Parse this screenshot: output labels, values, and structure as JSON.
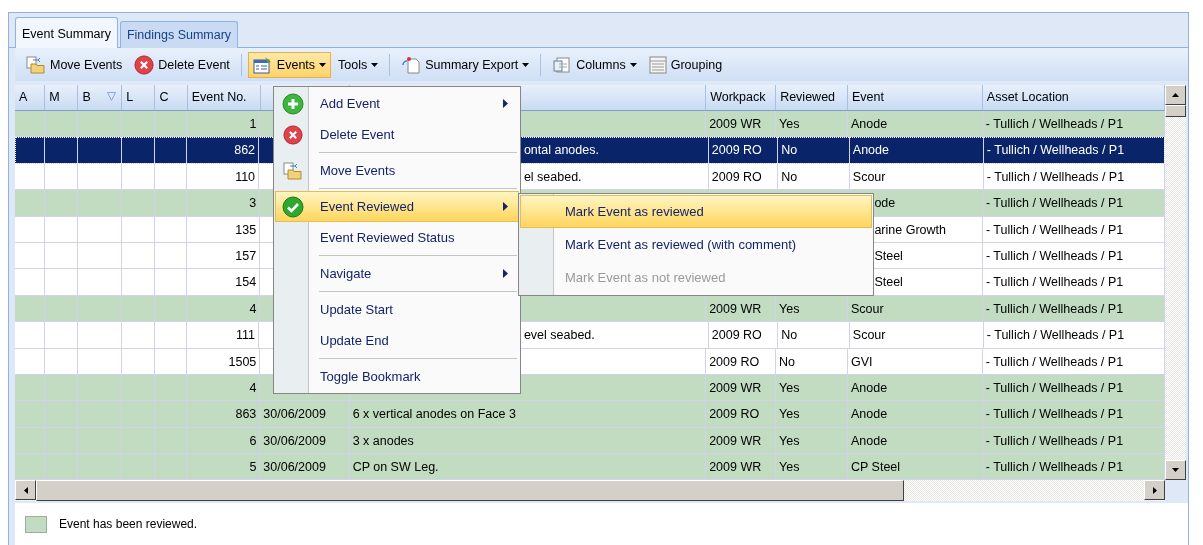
{
  "tabs": [
    {
      "label": "Event Summary",
      "selected": true
    },
    {
      "label": "Findings Summary",
      "selected": false
    }
  ],
  "toolbar": [
    [
      {
        "label": "Move Events",
        "kind": "move",
        "dropdown": false,
        "pressed": false
      },
      {
        "label": "Delete Event",
        "kind": "delete",
        "dropdown": false,
        "pressed": false
      }
    ],
    [
      {
        "label": "Events",
        "kind": "form",
        "dropdown": true,
        "pressed": true
      },
      {
        "label": "Tools",
        "dropdown": true,
        "pressed": false
      }
    ],
    [
      {
        "label": "Summary Export",
        "kind": "export",
        "dropdown": true,
        "pressed": false
      }
    ],
    [
      {
        "label": "Columns",
        "kind": "columns",
        "dropdown": true,
        "pressed": false
      },
      {
        "label": "Grouping",
        "kind": "grouping",
        "dropdown": false,
        "pressed": false
      }
    ]
  ],
  "grid": {
    "columns": {
      "a": "A",
      "m": "M",
      "b": "B",
      "l": "L",
      "c": "C",
      "event_no": "Event No.",
      "workpack": "Workpack",
      "reviewed": "Reviewed",
      "event": "Event",
      "asset_location": "Asset Location"
    },
    "rows": [
      {
        "selected": false,
        "is_reviewed": true,
        "event_no": "1",
        "workpack": "2009 WR",
        "reviewed": "Yes",
        "event": "Anode",
        "asset_location": "- Tullich / Wellheads / P1"
      },
      {
        "selected": true,
        "is_reviewed": false,
        "event_no": "862",
        "description": "ontal anodes.",
        "description_cut": true,
        "workpack": "2009 RO",
        "reviewed": "No",
        "event": "Anode",
        "asset_location": "- Tullich / Wellheads / P1"
      },
      {
        "selected": false,
        "is_reviewed": false,
        "event_no": "110",
        "description": "el seabed.",
        "description_cut": true,
        "workpack": "2009 RO",
        "reviewed": "No",
        "event": "Scour",
        "asset_location": "- Tullich / Wellheads / P1"
      },
      {
        "selected": false,
        "is_reviewed": true,
        "event_no": "3",
        "event": "ode",
        "event_cut": true,
        "asset_location": "- Tullich / Wellheads / P1"
      },
      {
        "selected": false,
        "is_reviewed": false,
        "event_no": "135",
        "event": "arine Growth",
        "event_cut": true,
        "asset_location": "- Tullich / Wellheads / P1"
      },
      {
        "selected": false,
        "is_reviewed": false,
        "event_no": "157",
        "event": "Steel",
        "event_cut": true,
        "asset_location": "- Tullich / Wellheads / P1"
      },
      {
        "selected": false,
        "is_reviewed": false,
        "event_no": "154",
        "event": "Steel",
        "event_cut": true,
        "asset_location": "- Tullich / Wellheads / P1"
      },
      {
        "selected": false,
        "is_reviewed": true,
        "event_no": "4",
        "workpack": "2009 WR",
        "reviewed": "Yes",
        "event": "Scour",
        "asset_location": "- Tullich / Wellheads / P1"
      },
      {
        "selected": false,
        "is_reviewed": false,
        "event_no": "111",
        "description": "evel seabed.",
        "description_cut": true,
        "workpack": "2009 RO",
        "reviewed": "No",
        "event": "Scour",
        "asset_location": "- Tullich / Wellheads / P1"
      },
      {
        "selected": false,
        "is_reviewed": false,
        "event_no": "1505",
        "workpack": "2009 RO",
        "reviewed": "No",
        "event": "GVI",
        "asset_location": "- Tullich / Wellheads / P1"
      },
      {
        "selected": false,
        "is_reviewed": true,
        "event_no": "4",
        "workpack": "2009 WR",
        "reviewed": "Yes",
        "event": "Anode",
        "asset_location": "- Tullich / Wellheads / P1"
      },
      {
        "selected": false,
        "is_reviewed": true,
        "event_no": "863",
        "date": "30/06/2009",
        "description": "6 x vertical anodes on Face 3",
        "workpack": "2009 RO",
        "reviewed": "Yes",
        "event": "Anode",
        "asset_location": "- Tullich / Wellheads / P1"
      },
      {
        "selected": false,
        "is_reviewed": true,
        "event_no": "6",
        "date": "30/06/2009",
        "description": "3 x anodes",
        "workpack": "2009 WR",
        "reviewed": "Yes",
        "event": "Anode",
        "asset_location": "- Tullich / Wellheads / P1"
      },
      {
        "selected": false,
        "is_reviewed": true,
        "event_no": "5",
        "date": "30/06/2009",
        "description": "CP on SW Leg.",
        "workpack": "2009 WR",
        "reviewed": "Yes",
        "event": "CP Steel",
        "asset_location": "- Tullich / Wellheads / P1"
      }
    ]
  },
  "context_menu": [
    [
      {
        "label": "Add Event",
        "kind": "add",
        "submenu": true,
        "highlighted": false
      },
      {
        "label": "Delete Event",
        "kind": "delete",
        "submenu": false,
        "highlighted": false
      }
    ],
    [
      {
        "label": "Move Events",
        "kind": "move",
        "submenu": false,
        "highlighted": false
      }
    ],
    [
      {
        "label": "Event Reviewed",
        "kind": "check",
        "submenu": true,
        "highlighted": true
      },
      {
        "label": "Event Reviewed Status",
        "submenu": false,
        "highlighted": false
      }
    ],
    [
      {
        "label": "Navigate",
        "submenu": true,
        "highlighted": false
      }
    ],
    [
      {
        "label": "Update Start",
        "submenu": false,
        "highlighted": false
      },
      {
        "label": "Update End",
        "submenu": false,
        "highlighted": false
      }
    ],
    [
      {
        "label": "Toggle Bookmark",
        "submenu": false,
        "highlighted": false
      }
    ]
  ],
  "submenu": [
    {
      "label": "Mark Event as reviewed",
      "highlighted": true,
      "disabled": false
    },
    {
      "label": "Mark Event as reviewed (with comment)",
      "highlighted": false,
      "disabled": false
    },
    {
      "label": "Mark Event as not reviewed",
      "highlighted": false,
      "disabled": true
    }
  ],
  "legend": {
    "label": "Event has been reviewed."
  }
}
